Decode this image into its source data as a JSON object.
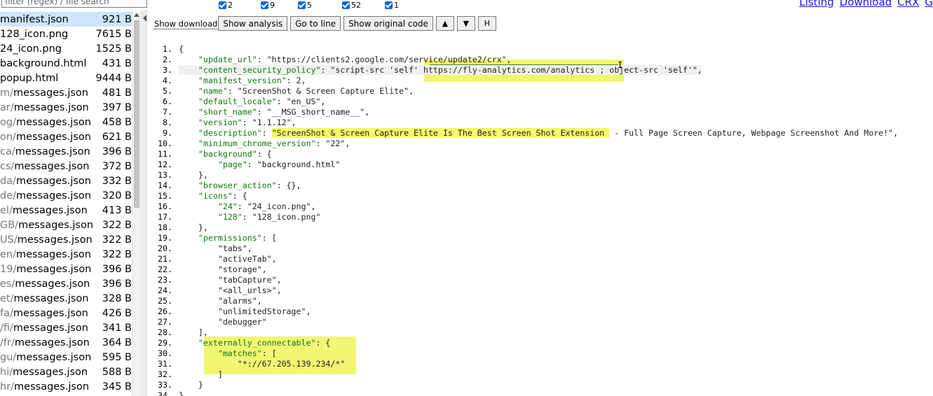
{
  "filter": {
    "placeholder": "filter (regex) / file search"
  },
  "checkboxes": [
    {
      "label": "2"
    },
    {
      "label": "9"
    },
    {
      "label": "5"
    },
    {
      "label": "52"
    },
    {
      "label": "1"
    }
  ],
  "top_links": [
    "Listing",
    "Download",
    "CRX",
    "G"
  ],
  "files": [
    {
      "prefix": "",
      "name": "manifest.json",
      "size": "921 B",
      "selected": true
    },
    {
      "prefix": "",
      "name": "128_icon.png",
      "size": "7615 B"
    },
    {
      "prefix": "",
      "name": "24_icon.png",
      "size": "1525 B"
    },
    {
      "prefix": "",
      "name": "background.html",
      "size": "431 B"
    },
    {
      "prefix": "",
      "name": "popup.html",
      "size": "9444 B"
    },
    {
      "prefix": "m/",
      "name": "messages.json",
      "size": "481 B"
    },
    {
      "prefix": "ar/",
      "name": "messages.json",
      "size": "397 B"
    },
    {
      "prefix": "og/",
      "name": "messages.json",
      "size": "458 B"
    },
    {
      "prefix": "on/",
      "name": "messages.json",
      "size": "621 B"
    },
    {
      "prefix": "ca/",
      "name": "messages.json",
      "size": "396 B"
    },
    {
      "prefix": "cs/",
      "name": "messages.json",
      "size": "372 B"
    },
    {
      "prefix": "da/",
      "name": "messages.json",
      "size": "332 B"
    },
    {
      "prefix": "de/",
      "name": "messages.json",
      "size": "320 B"
    },
    {
      "prefix": "el/",
      "name": "messages.json",
      "size": "413 B"
    },
    {
      "prefix": "GB/",
      "name": "messages.json",
      "size": "322 B"
    },
    {
      "prefix": "US/",
      "name": "messages.json",
      "size": "322 B"
    },
    {
      "prefix": "en/",
      "name": "messages.json",
      "size": "322 B"
    },
    {
      "prefix": "19/",
      "name": "messages.json",
      "size": "396 B"
    },
    {
      "prefix": "es/",
      "name": "messages.json",
      "size": "396 B"
    },
    {
      "prefix": "et/",
      "name": "messages.json",
      "size": "328 B"
    },
    {
      "prefix": "fa/",
      "name": "messages.json",
      "size": "426 B"
    },
    {
      "prefix": "/fi/",
      "name": "messages.json",
      "size": "341 B"
    },
    {
      "prefix": "/fr/",
      "name": "messages.json",
      "size": "364 B"
    },
    {
      "prefix": "gu/",
      "name": "messages.json",
      "size": "595 B"
    },
    {
      "prefix": "hi/",
      "name": "messages.json",
      "size": "588 B"
    },
    {
      "prefix": "hr/",
      "name": "messages.json",
      "size": "345 B"
    }
  ],
  "toolbar": {
    "download_label": "Show download",
    "show_analysis": "Show analysis",
    "go_to_line": "Go to line",
    "show_original": "Show original code",
    "up": "▲",
    "down": "▼",
    "h": "H"
  },
  "code_lines": [
    {
      "n": "1.",
      "t": "{"
    },
    {
      "n": "2.",
      "t": "    \"update_url\": \"https://clients2.google.com/service/update2/crx\","
    },
    {
      "n": "3.",
      "t": "    \"content_security_policy\": \"script-src 'self' https://fly-analytics.com/analytics ; object-src 'self'\",",
      "hl": true
    },
    {
      "n": "4.",
      "t": "    \"manifest_version\": 2,"
    },
    {
      "n": "5.",
      "t": "    \"name\": \"ScreenShot & Screen Capture Elite\","
    },
    {
      "n": "6.",
      "t": "    \"default_locale\": \"en_US\","
    },
    {
      "n": "7.",
      "t": "    \"short_name\": \"__MSG_short_name__\","
    },
    {
      "n": "8.",
      "t": "    \"version\": \"1.1.12\","
    },
    {
      "n": "9.",
      "t": "    \"description\": \"ScreenShot & Screen Capture Elite Is The Best Screen Shot Extension - Full Page Screen Capture, Webpage Screenshot And More!\","
    },
    {
      "n": "10.",
      "t": "    \"minimum_chrome_version\": \"22\","
    },
    {
      "n": "11.",
      "t": "    \"background\": {"
    },
    {
      "n": "12.",
      "t": "        \"page\": \"background.html\""
    },
    {
      "n": "13.",
      "t": "    },"
    },
    {
      "n": "14.",
      "t": "    \"browser_action\": {},"
    },
    {
      "n": "15.",
      "t": "    \"icons\": {"
    },
    {
      "n": "16.",
      "t": "        \"24\": \"24_icon.png\","
    },
    {
      "n": "17.",
      "t": "        \"128\": \"128_icon.png\""
    },
    {
      "n": "18.",
      "t": "    },"
    },
    {
      "n": "19.",
      "t": "    \"permissions\": ["
    },
    {
      "n": "20.",
      "t": "        \"tabs\","
    },
    {
      "n": "21.",
      "t": "        \"activeTab\","
    },
    {
      "n": "22.",
      "t": "        \"storage\","
    },
    {
      "n": "23.",
      "t": "        \"tabCapture\","
    },
    {
      "n": "24.",
      "t": "        \"<all_urls>\","
    },
    {
      "n": "25.",
      "t": "        \"alarms\","
    },
    {
      "n": "26.",
      "t": "        \"unlimitedStorage\","
    },
    {
      "n": "27.",
      "t": "        \"debugger\""
    },
    {
      "n": "28.",
      "t": "    ],"
    },
    {
      "n": "29.",
      "t": "    \"externally_connectable\": {"
    },
    {
      "n": "30.",
      "t": "        \"matches\": ["
    },
    {
      "n": "31.",
      "t": "            \"*://67.205.139.234/*\""
    },
    {
      "n": "32.",
      "t": "        ]"
    },
    {
      "n": "33.",
      "t": "    }"
    },
    {
      "n": "34.",
      "t": "}"
    }
  ],
  "colors": {
    "highlight_yellow": "#f6f96b",
    "highlight_green": "#3c8a2e",
    "selected_row": "#cde5ff",
    "link": "#1a1ae6"
  }
}
